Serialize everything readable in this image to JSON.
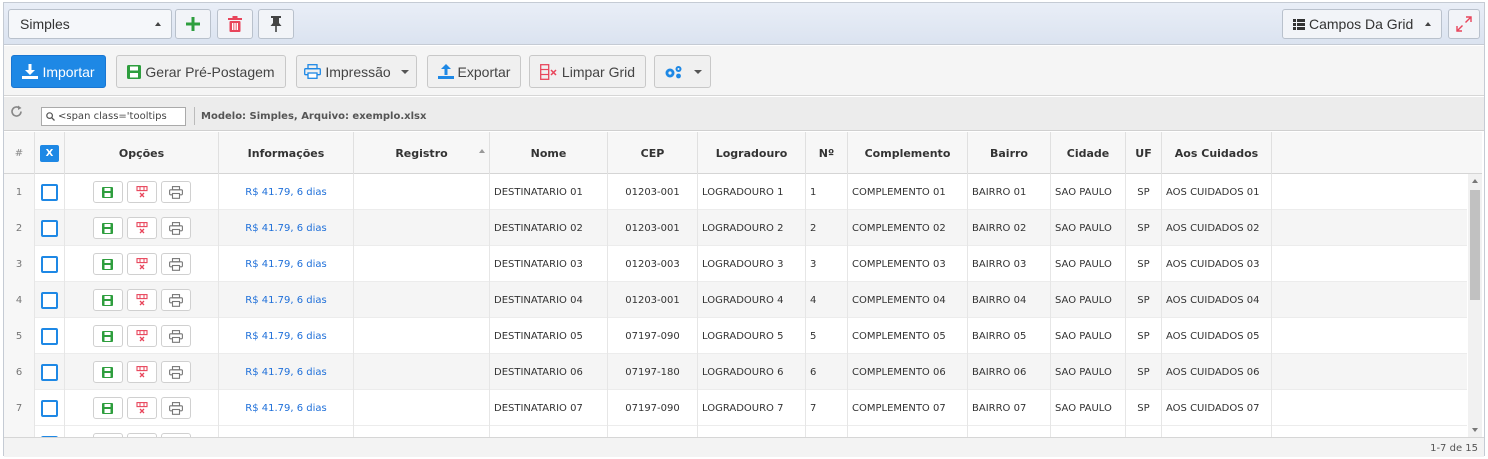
{
  "toolbar": {
    "layout_value": "Simples",
    "campos_label": "Campos Da Grid"
  },
  "actions": {
    "importar": "Importar",
    "gerar": "Gerar Pré-Postagem",
    "impressao": "Impressão",
    "exportar": "Exportar",
    "limpar": "Limpar Grid"
  },
  "filter": {
    "search_value": "<span class='tooltips",
    "modelo": "Modelo: Simples, Arquivo: exemplo.xlsx"
  },
  "grid": {
    "headers": {
      "num": "#",
      "select_all": "X",
      "opcoes": "Opções",
      "informacoes": "Informações",
      "registro": "Registro",
      "nome": "Nome",
      "cep": "CEP",
      "logradouro": "Logradouro",
      "numero": "Nº",
      "complemento": "Complemento",
      "bairro": "Bairro",
      "cidade": "Cidade",
      "uf": "UF",
      "aos_cuidados": "Aos Cuidados"
    },
    "rows": [
      {
        "n": "1",
        "info": "R$ 41.79, 6 dias",
        "registro": "",
        "nome": "DESTINATARIO 01",
        "cep": "01203-001",
        "logradouro": "LOGRADOURO 1",
        "numero": "1",
        "complemento": "COMPLEMENTO 01",
        "bairro": "BAIRRO 01",
        "cidade": "SAO PAULO",
        "uf": "SP",
        "aos": "AOS CUIDADOS 01"
      },
      {
        "n": "2",
        "info": "R$ 41.79, 6 dias",
        "registro": "",
        "nome": "DESTINATARIO 02",
        "cep": "01203-001",
        "logradouro": "LOGRADOURO 2",
        "numero": "2",
        "complemento": "COMPLEMENTO 02",
        "bairro": "BAIRRO 02",
        "cidade": "SAO PAULO",
        "uf": "SP",
        "aos": "AOS CUIDADOS 02"
      },
      {
        "n": "3",
        "info": "R$ 41.79, 6 dias",
        "registro": "",
        "nome": "DESTINATARIO 03",
        "cep": "01203-003",
        "logradouro": "LOGRADOURO 3",
        "numero": "3",
        "complemento": "COMPLEMENTO 03",
        "bairro": "BAIRRO 03",
        "cidade": "SAO PAULO",
        "uf": "SP",
        "aos": "AOS CUIDADOS 03"
      },
      {
        "n": "4",
        "info": "R$ 41.79, 6 dias",
        "registro": "",
        "nome": "DESTINATARIO 04",
        "cep": "01203-001",
        "logradouro": "LOGRADOURO 4",
        "numero": "4",
        "complemento": "COMPLEMENTO 04",
        "bairro": "BAIRRO 04",
        "cidade": "SAO PAULO",
        "uf": "SP",
        "aos": "AOS CUIDADOS 04"
      },
      {
        "n": "5",
        "info": "R$ 41.79, 6 dias",
        "registro": "",
        "nome": "DESTINATARIO 05",
        "cep": "07197-090",
        "logradouro": "LOGRADOURO 5",
        "numero": "5",
        "complemento": "COMPLEMENTO 05",
        "bairro": "BAIRRO 05",
        "cidade": "SAO PAULO",
        "uf": "SP",
        "aos": "AOS CUIDADOS 05"
      },
      {
        "n": "6",
        "info": "R$ 41.79, 6 dias",
        "registro": "",
        "nome": "DESTINATARIO 06",
        "cep": "07197-180",
        "logradouro": "LOGRADOURO 6",
        "numero": "6",
        "complemento": "COMPLEMENTO 06",
        "bairro": "BAIRRO 06",
        "cidade": "SAO PAULO",
        "uf": "SP",
        "aos": "AOS CUIDADOS 06"
      },
      {
        "n": "7",
        "info": "R$ 41.79, 6 dias",
        "registro": "",
        "nome": "DESTINATARIO 07",
        "cep": "07197-090",
        "logradouro": "LOGRADOURO 7",
        "numero": "7",
        "complemento": "COMPLEMENTO 07",
        "bairro": "BAIRRO 07",
        "cidade": "SAO PAULO",
        "uf": "SP",
        "aos": "AOS CUIDADOS 07"
      }
    ]
  },
  "footer": {
    "pager": "1-7 de 15"
  },
  "icons": {
    "add": "plus-icon",
    "delete": "trash-icon",
    "pin": "pin-icon",
    "expand": "expand-icon",
    "settings": "gears-icon",
    "refresh": "refresh-icon",
    "search": "search-icon"
  },
  "colors": {
    "primary": "#1e88e5",
    "add_green": "#2e9e3e",
    "delete_red": "#e8455b",
    "info_link": "#1e6fd9"
  }
}
